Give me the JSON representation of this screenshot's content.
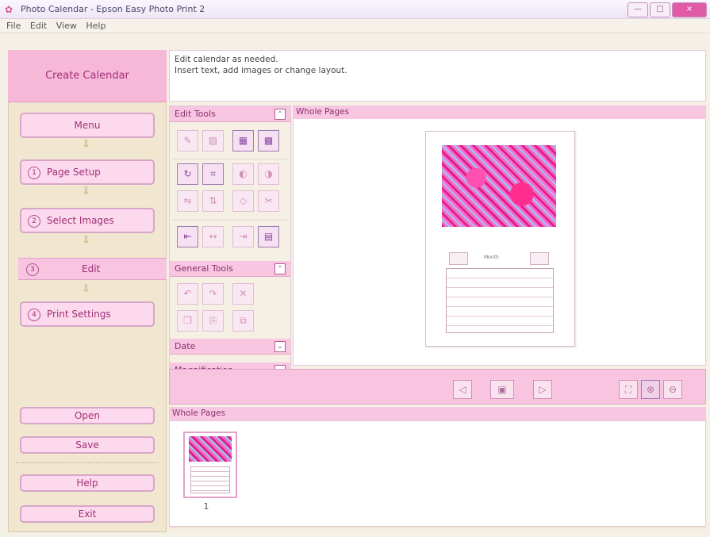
{
  "window": {
    "title": "Photo Calendar - Epson Easy Photo Print 2",
    "buttons": {
      "minimize": "—",
      "maximize": "□",
      "close": "×"
    }
  },
  "menu": [
    "File",
    "Edit",
    "View",
    "Help"
  ],
  "sidebar": {
    "header": "Create Calendar",
    "steps": {
      "menu": "Menu",
      "page_setup_num": "1",
      "page_setup": "Page Setup",
      "select_images_num": "2",
      "select_images": "Select Images",
      "edit_num": "3",
      "edit": "Edit",
      "print_settings_num": "4",
      "print_settings": "Print Settings"
    },
    "open": "Open",
    "save": "Save",
    "help": "Help",
    "exit": "Exit"
  },
  "instructions": {
    "line1": "Edit calendar as needed.",
    "line2": "Insert text, add images or change layout."
  },
  "tools": {
    "edit_tools": "Edit Tools",
    "general_tools": "General Tools",
    "date": "Date",
    "magnification": "Magnification"
  },
  "preview": {
    "title": "Whole Pages",
    "month": "Month"
  },
  "whole_pages": {
    "title": "Whole Pages",
    "page_num": "1"
  },
  "icons": {
    "arrow": "⇩",
    "chev": "⌃",
    "prev": "◁",
    "next": "▷",
    "fit": "▣",
    "zoomin": "⊕",
    "zoomout": "⊖"
  },
  "colors": {
    "accent": "#f8c4e0",
    "accent_text": "#a03078",
    "panel": "#f1e6d0"
  }
}
